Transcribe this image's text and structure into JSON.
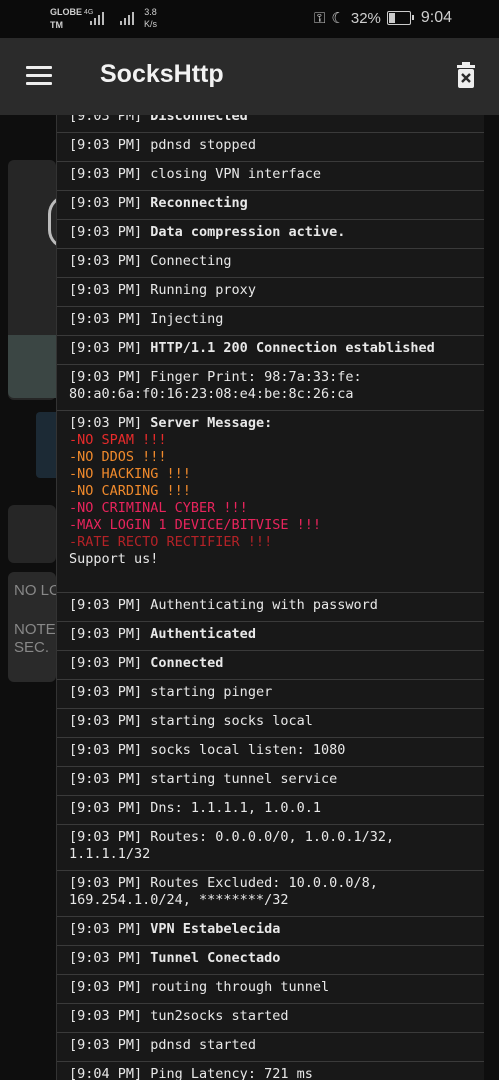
{
  "status_bar": {
    "carrier": "GLOBE\nTM",
    "network": "4G",
    "speed": "3.8\nK/s",
    "battery": "32%",
    "time": "9:04"
  },
  "app_bar": {
    "title": "SocksHttp"
  },
  "background": {
    "notice_line1": "NO LO",
    "notice_line2": "NOTE",
    "notice_line3": "SEC."
  },
  "log": [
    {
      "ts": "[9:03 PM]",
      "msg": "Disconnected",
      "bold": true
    },
    {
      "ts": "[9:03 PM]",
      "msg": "pdnsd stopped",
      "bold": false
    },
    {
      "ts": "[9:03 PM]",
      "msg": "closing VPN interface",
      "bold": false
    },
    {
      "ts": "[9:03 PM]",
      "msg": "Reconnecting",
      "bold": true
    },
    {
      "ts": "[9:03 PM]",
      "msg": "Data compression active.",
      "bold": true
    },
    {
      "ts": "[9:03 PM]",
      "msg": "Connecting",
      "bold": false
    },
    {
      "ts": "[9:03 PM]",
      "msg": "Running proxy",
      "bold": false
    },
    {
      "ts": "[9:03 PM]",
      "msg": "Injecting",
      "bold": false
    },
    {
      "ts": "[9:03 PM]",
      "msg": "HTTP/1.1 200 Connection established",
      "bold": true
    },
    {
      "ts": "[9:03 PM]",
      "msg": "Finger Print: 98:7a:33:fe:\n80:a0:6a:f0:16:23:08:e4:be:8c:26:ca",
      "bold": false
    },
    {
      "ts": "[9:03 PM]",
      "msg": "Server Message:",
      "bold": true,
      "lines": [
        {
          "text": "-NO SPAM !!!",
          "color": "red"
        },
        {
          "text": "-NO DDOS !!!",
          "color": "orange"
        },
        {
          "text": "-NO HACKING !!!",
          "color": "orange"
        },
        {
          "text": "-NO CARDING !!!",
          "color": "orange"
        },
        {
          "text": "-NO CRIMINAL CYBER !!!",
          "color": "magenta"
        },
        {
          "text": "-MAX LOGIN 1 DEVICE/BITVISE !!!",
          "color": "magenta"
        },
        {
          "text": "-RATE RECTO RECTIFIER !!!",
          "color": "dim"
        },
        {
          "text": "Support us!",
          "color": "plain"
        }
      ]
    },
    {
      "ts": "[9:03 PM]",
      "msg": "Authenticating with password",
      "bold": false
    },
    {
      "ts": "[9:03 PM]",
      "msg": "Authenticated",
      "bold": true
    },
    {
      "ts": "[9:03 PM]",
      "msg": "Connected",
      "bold": true
    },
    {
      "ts": "[9:03 PM]",
      "msg": "starting pinger",
      "bold": false
    },
    {
      "ts": "[9:03 PM]",
      "msg": "starting socks local",
      "bold": false
    },
    {
      "ts": "[9:03 PM]",
      "msg": "socks local listen: 1080",
      "bold": false
    },
    {
      "ts": "[9:03 PM]",
      "msg": "starting tunnel service",
      "bold": false
    },
    {
      "ts": "[9:03 PM]",
      "msg": "Dns: 1.1.1.1, 1.0.0.1",
      "bold": false
    },
    {
      "ts": "[9:03 PM]",
      "msg": "Routes: 0.0.0.0/0, 1.0.0.1/32,\n1.1.1.1/32",
      "bold": false
    },
    {
      "ts": "[9:03 PM]",
      "msg": "Routes Excluded: 10.0.0.0/8,\n169.254.1.0/24, ********/32",
      "bold": false
    },
    {
      "ts": "[9:03 PM]",
      "msg": "VPN Estabelecida",
      "bold": true
    },
    {
      "ts": "[9:03 PM]",
      "msg": "Tunnel Conectado",
      "bold": true
    },
    {
      "ts": "[9:03 PM]",
      "msg": "routing through tunnel",
      "bold": false
    },
    {
      "ts": "[9:03 PM]",
      "msg": "tun2socks started",
      "bold": false
    },
    {
      "ts": "[9:03 PM]",
      "msg": "pdnsd started",
      "bold": false
    },
    {
      "ts": "[9:04 PM]",
      "msg": "Ping Latency: 721 ms",
      "bold": false
    }
  ]
}
